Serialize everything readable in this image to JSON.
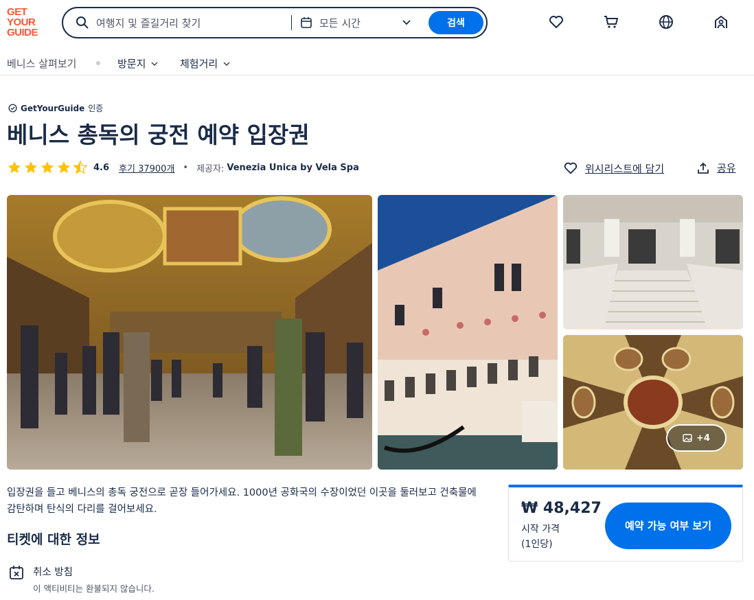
{
  "brand": {
    "logo_lines": [
      "GET",
      "YOUR",
      "GUIDE"
    ],
    "color": "#ff5533"
  },
  "search": {
    "placeholder": "여행지 및 즐길거리 찾기",
    "time_value": "모든 시간",
    "button_label": "검색",
    "accent": "#0071eb"
  },
  "header_icons": [
    "heart-icon",
    "cart-icon",
    "globe-icon",
    "profile-icon"
  ],
  "subnav": {
    "items": [
      {
        "label": "베니스 살펴보기"
      },
      {
        "label": "방문지"
      },
      {
        "label": "체험거리"
      }
    ]
  },
  "badge": {
    "brand": "GetYourGuide",
    "suffix": "인증"
  },
  "title": "베니스 총독의 궁전 예약 입장권",
  "rating": {
    "score": "4.6",
    "reviews": "후기 37900개",
    "provider_label": "제공자:",
    "provider_name": "Venezia Unica by Vela Spa",
    "stars": 4.5
  },
  "actions": {
    "wishlist": "위시리스트에 담기",
    "share": "공유"
  },
  "gallery": {
    "more_label": "+4"
  },
  "description": "입장권을 들고 베니스의 총독 궁전으로 곧장 들어가세요. 1000년 공화국의 수장이었던 이곳을 둘러보고 건축물에 감탄하며 탄식의 다리를 걸어보세요.",
  "ticket_info": {
    "heading": "티켓에 대한 정보",
    "policy_title": "취소 방침",
    "policy_desc": "이 액티비티는 환불되지 않습니다."
  },
  "price": {
    "amount": "₩ 48,427",
    "from_label": "시작 가격",
    "per_label": "(1인당)",
    "cta_label": "예약 가능 여부 보기"
  }
}
